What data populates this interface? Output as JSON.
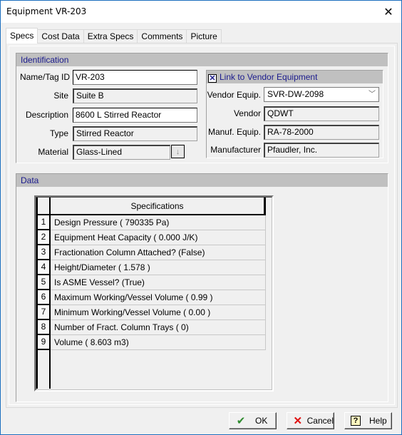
{
  "window": {
    "title": "Equipment VR-203",
    "close_glyph": "✕"
  },
  "tabs": [
    {
      "label": "Specs",
      "active": true
    },
    {
      "label": "Cost Data",
      "active": false
    },
    {
      "label": "Extra Specs",
      "active": false
    },
    {
      "label": "Comments",
      "active": false
    },
    {
      "label": "Picture",
      "active": false
    }
  ],
  "identification": {
    "header": "Identification",
    "fields": {
      "name_tag_id": {
        "label": "Name/Tag ID",
        "value": "VR-203"
      },
      "site": {
        "label": "Site",
        "value": "Suite B"
      },
      "description": {
        "label": "Description",
        "value": "8600 L Stirred Reactor"
      },
      "type": {
        "label": "Type",
        "value": "Stirred Reactor"
      },
      "material": {
        "label": "Material",
        "value": "Glass-Lined"
      }
    },
    "material_dropdown_icon": "↓"
  },
  "vendor": {
    "header": "Link to Vendor Equipment",
    "link_checked": true,
    "checkbox_glyph": "✕",
    "fields": {
      "vendor_equip": {
        "label": "Vendor Equip.",
        "value": "SVR-DW-2098"
      },
      "vendor": {
        "label": "Vendor",
        "value": "QDWT"
      },
      "manuf_equip": {
        "label": "Manuf. Equip.",
        "value": "RA-78-2000"
      },
      "manufacturer": {
        "label": "Manufacturer",
        "value": "Pfaudler, Inc."
      }
    },
    "chevron_glyph": "﹀"
  },
  "data_section": {
    "header": "Data",
    "grid_header": "Specifications",
    "rows": [
      {
        "num": "1",
        "text": "Design Pressure ( 790335 Pa)"
      },
      {
        "num": "2",
        "text": "Equipment Heat Capacity ( 0.000 J/K)"
      },
      {
        "num": "3",
        "text": "Fractionation Column Attached? (False)"
      },
      {
        "num": "4",
        "text": "Height/Diameter ( 1.578 )"
      },
      {
        "num": "5",
        "text": "Is ASME Vessel? (True)"
      },
      {
        "num": "6",
        "text": "Maximum Working/Vessel Volume ( 0.99 )"
      },
      {
        "num": "7",
        "text": "Minimum Working/Vessel Volume ( 0.00 )"
      },
      {
        "num": "8",
        "text": "Number of Fract. Column Trays (   0)"
      },
      {
        "num": "9",
        "text": "Volume ( 8.603 m3)"
      }
    ]
  },
  "buttons": {
    "ok": {
      "label": "OK",
      "icon": "✔",
      "icon_color": "#2e8b2e"
    },
    "cancel": {
      "label": "Cancel",
      "icon": "✕",
      "icon_color": "#e01010"
    },
    "help": {
      "label": "Help",
      "icon": "?"
    }
  }
}
